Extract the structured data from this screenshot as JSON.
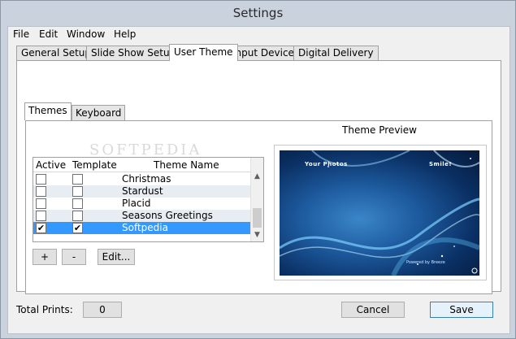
{
  "window": {
    "title": "Settings"
  },
  "menu": [
    "File",
    "Edit",
    "Window",
    "Help"
  ],
  "tabs": [
    "General Setup",
    "Slide Show Setup",
    "User Theme",
    "Input Devices",
    "Digital Delivery"
  ],
  "active_tab": "User Theme",
  "subtabs": [
    "Themes",
    "Keyboard"
  ],
  "list": {
    "headers": {
      "active": "Active",
      "template": "Template",
      "name": "Theme Name"
    },
    "rows": [
      {
        "name": "Christmas",
        "active": false,
        "template": false
      },
      {
        "name": "Stardust",
        "active": false,
        "template": false
      },
      {
        "name": "Placid",
        "active": false,
        "template": false
      },
      {
        "name": "Seasons Greetings",
        "active": false,
        "template": false
      },
      {
        "name": "Softpedia",
        "active": true,
        "template": true
      }
    ]
  },
  "buttons": {
    "add": "+",
    "remove": "-",
    "edit": "Edit...",
    "cancel": "Cancel",
    "save": "Save"
  },
  "preview": {
    "heading": "Theme Preview",
    "left_caption": "Your Photos",
    "right_caption": "Smile!",
    "footer_caption": "Powered by Breeze"
  },
  "watermark": "SOFTPEDIA",
  "footer": {
    "total_prints_label": "Total Prints:",
    "total_prints_value": "0"
  },
  "colors": {
    "selection": "#3399ff",
    "preview_bg": "#0a2f63"
  }
}
